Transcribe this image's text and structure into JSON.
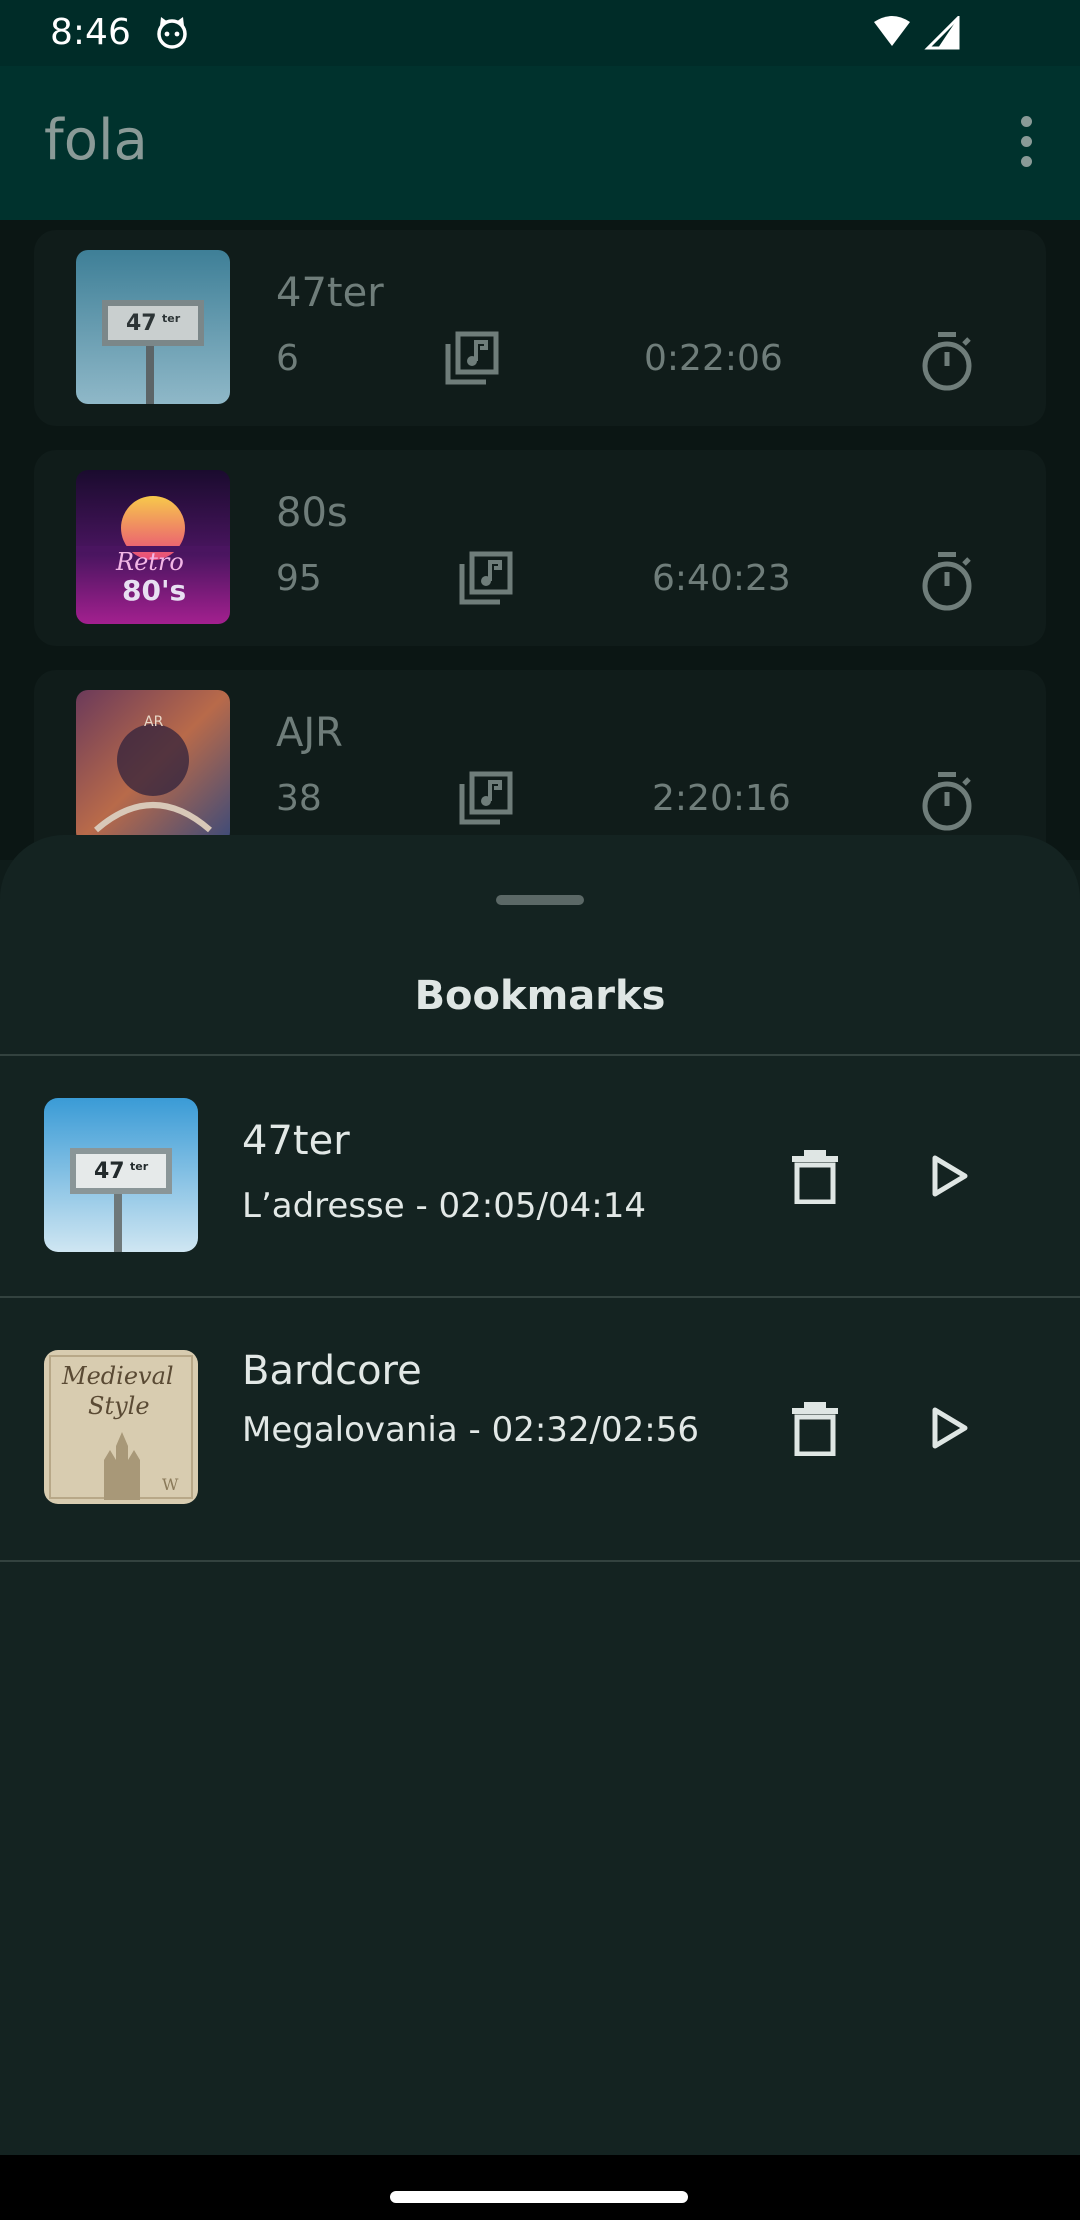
{
  "status_bar": {
    "time": "8:46"
  },
  "app_bar": {
    "title": "fola"
  },
  "playlists": [
    {
      "name": "47ter",
      "count": "6",
      "duration": "0:22:06"
    },
    {
      "name": "80s",
      "count": "95",
      "duration": "6:40:23"
    },
    {
      "name": "AJR",
      "count": "38",
      "duration": "2:20:16"
    }
  ],
  "bookmarks_sheet": {
    "title": "Bookmarks",
    "items": [
      {
        "title": "47ter",
        "subtitle": "L’adresse - 02:05/04:14"
      },
      {
        "title": "Bardcore",
        "subtitle": "Megalovania - 02:32/02:56"
      }
    ]
  }
}
